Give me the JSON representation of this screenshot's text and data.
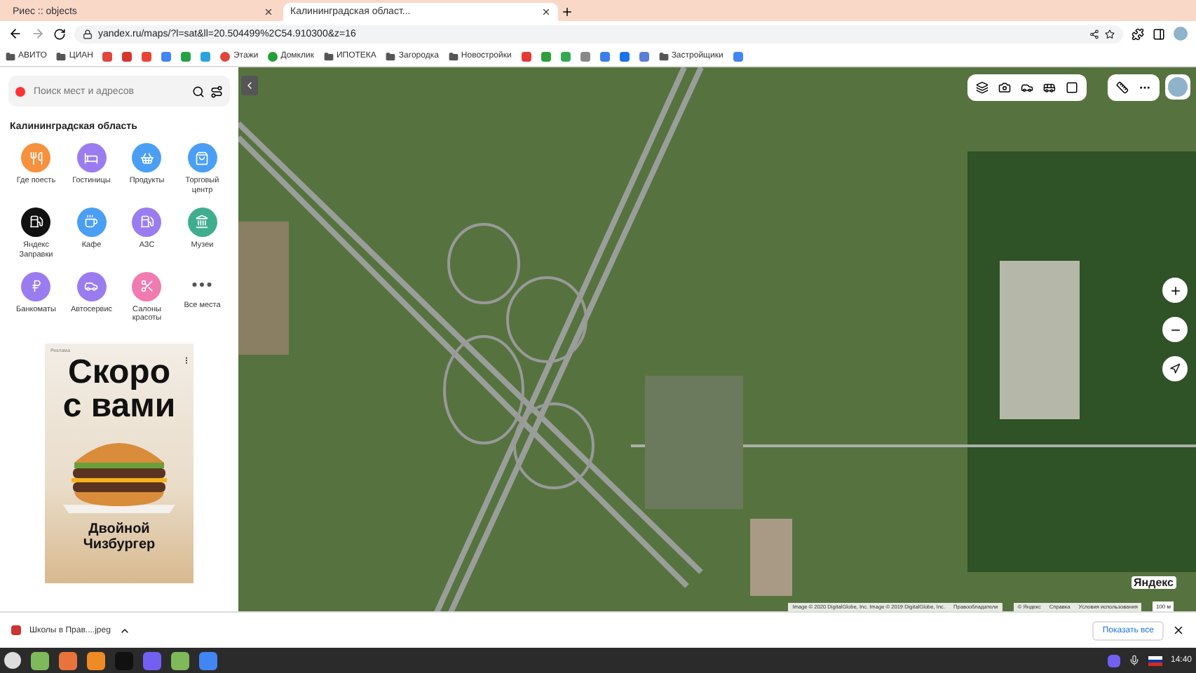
{
  "browser": {
    "tabs": [
      {
        "title": "Риес :: objects",
        "selected": false
      },
      {
        "title": "Калининградская област...",
        "selected": true
      }
    ],
    "address": "yandex.ru/maps/?l=sat&ll=20.504499%2C54.910300&z=16",
    "bookmarks": [
      {
        "kind": "folder",
        "label": "АВИТО"
      },
      {
        "kind": "folder",
        "label": "ЦИАН"
      },
      {
        "kind": "icon",
        "color": "#e0463c"
      },
      {
        "kind": "icon",
        "color": "#d9342b"
      },
      {
        "kind": "icon",
        "color": "#ea4335"
      },
      {
        "kind": "icon",
        "color": "#4285f4"
      },
      {
        "kind": "icon",
        "color": "#25a244"
      },
      {
        "kind": "icon",
        "color": "#2aa3e0"
      },
      {
        "kind": "site",
        "label": "Этажи",
        "color": "#e0463c"
      },
      {
        "kind": "site",
        "label": "Домклик",
        "color": "#21a038"
      },
      {
        "kind": "folder",
        "label": "ИПОТЕКА"
      },
      {
        "kind": "folder",
        "label": "Загородка"
      },
      {
        "kind": "folder",
        "label": "Новостройки"
      },
      {
        "kind": "icon",
        "color": "#e53935"
      },
      {
        "kind": "icon",
        "color": "#2e9d3a"
      },
      {
        "kind": "icon",
        "color": "#34a853"
      },
      {
        "kind": "icon",
        "color": "#888888"
      },
      {
        "kind": "icon",
        "color": "#3b7ded"
      },
      {
        "kind": "icon",
        "color": "#1a73e8"
      },
      {
        "kind": "icon",
        "color": "#5a7fd6"
      },
      {
        "kind": "folder",
        "label": "Застройщики"
      },
      {
        "kind": "icon",
        "color": "#4285f4"
      }
    ]
  },
  "sidebar": {
    "search": {
      "placeholder": "Поиск мест и адресов"
    },
    "region": "Калининградская область",
    "categories": [
      {
        "label": "Где поесть",
        "color": "#f7913d"
      },
      {
        "label": "Гостиницы",
        "color": "#9b7cf0"
      },
      {
        "label": "Продукты",
        "color": "#4a9ff5"
      },
      {
        "label": "Торговый центр",
        "color": "#4a9ff5"
      },
      {
        "label": "Яндекс Заправки",
        "color": "#111111"
      },
      {
        "label": "Кафе",
        "color": "#4a9ff5"
      },
      {
        "label": "АЗС",
        "color": "#9b7cf0"
      },
      {
        "label": "Музеи",
        "color": "#3fae8e"
      },
      {
        "label": "Банкоматы",
        "color": "#9b7cf0"
      },
      {
        "label": "Автосервис",
        "color": "#9b7cf0"
      },
      {
        "label": "Салоны красоты",
        "color": "#f07bb0"
      },
      {
        "label": "Все места",
        "kind": "more"
      }
    ],
    "ad": {
      "tag": "Реклама",
      "headline": "Скоро с вами",
      "caption": "Двойной Чизбургер"
    }
  },
  "map": {
    "attribution": "Image © 2020 DigitalGlobe, Inc. Image © 2019 DigitalGlobe, Inc.",
    "rights": "Правообладатели",
    "links": [
      "© Яндекс",
      "Справка",
      "Условия использования"
    ],
    "scale": "100 м",
    "logo": "Яндекс"
  },
  "downloads": {
    "file": "Школы в Прав....jpeg",
    "show_all": "Показать все"
  },
  "taskbar": {
    "time": "14:40"
  }
}
